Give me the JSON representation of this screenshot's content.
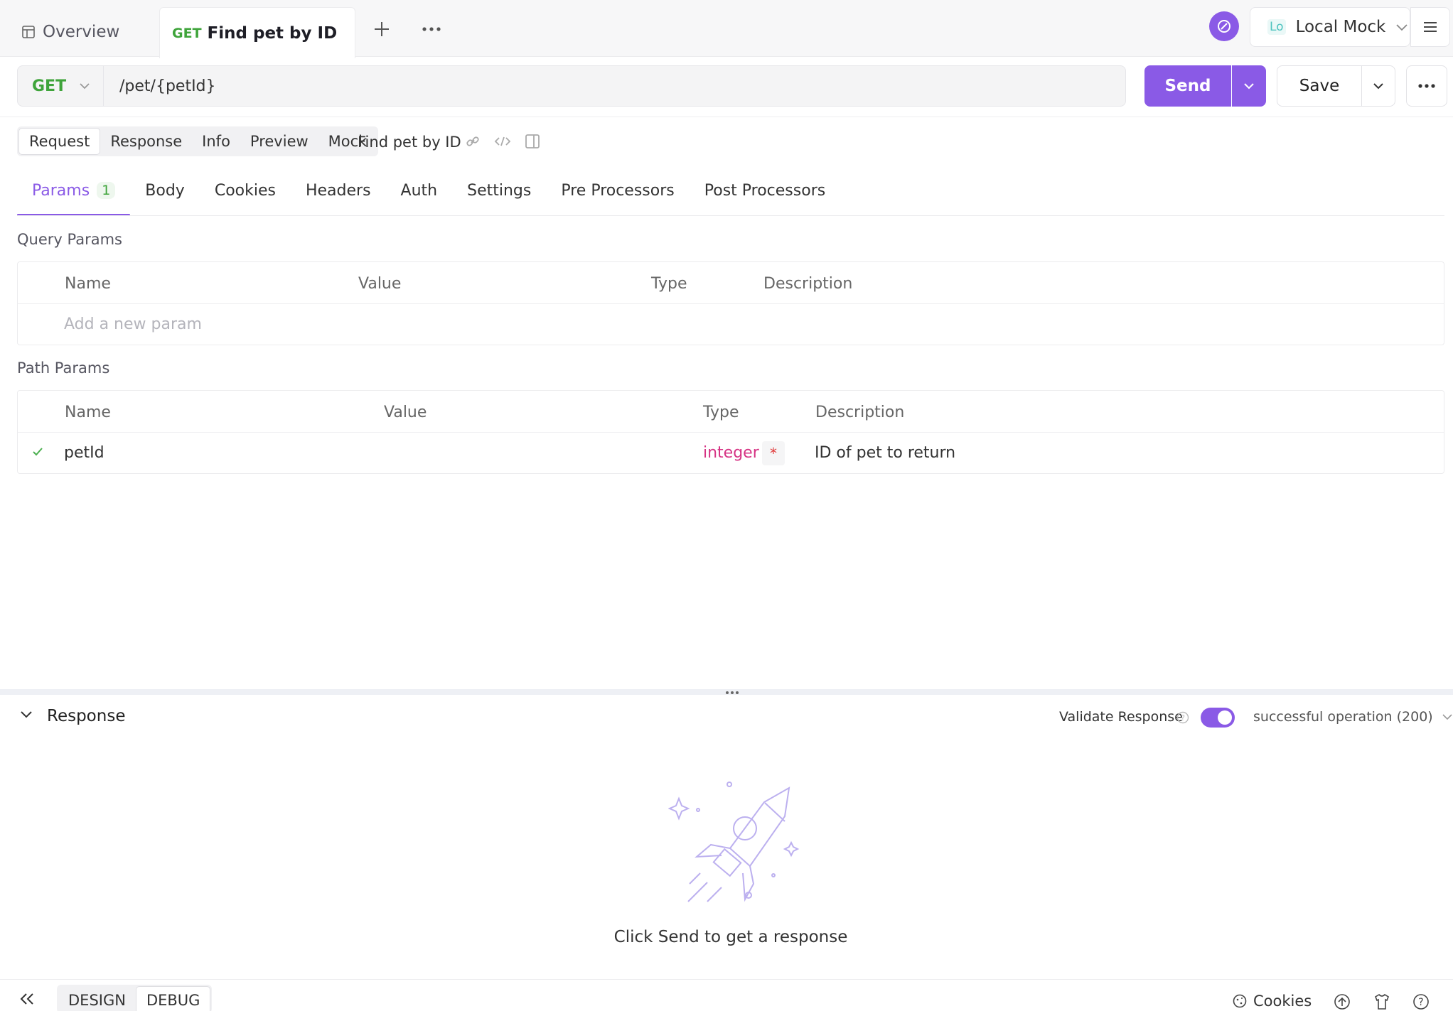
{
  "tabs": {
    "overview_label": "Overview",
    "active_method": "GET",
    "active_title": "Find pet by ID"
  },
  "environment": {
    "badge": "Lo",
    "name": "Local Mock"
  },
  "request": {
    "method": "GET",
    "url": "/pet/{petId}",
    "send_label": "Send",
    "save_label": "Save"
  },
  "views": {
    "items": [
      "Request",
      "Response",
      "Info",
      "Preview",
      "Mock"
    ],
    "active": "Request",
    "api_name": "Find pet by ID"
  },
  "param_tabs": {
    "items": [
      {
        "label": "Params",
        "count": "1"
      },
      {
        "label": "Body"
      },
      {
        "label": "Cookies"
      },
      {
        "label": "Headers"
      },
      {
        "label": "Auth"
      },
      {
        "label": "Settings"
      },
      {
        "label": "Pre Processors"
      },
      {
        "label": "Post Processors"
      }
    ]
  },
  "query_params": {
    "title": "Query Params",
    "columns": [
      "Name",
      "Value",
      "Type",
      "Description"
    ],
    "placeholder": "Add a new param"
  },
  "path_params": {
    "title": "Path Params",
    "columns": [
      "Name",
      "Value",
      "Type",
      "Description"
    ],
    "rows": [
      {
        "name": "petId",
        "value": "",
        "type": "integer",
        "required_mark": "*",
        "description": "ID of pet to return"
      }
    ]
  },
  "response": {
    "title": "Response",
    "validate_label": "Validate Response",
    "validate_on": true,
    "status_select": "successful operation (200)",
    "empty_message": "Click Send to get a response"
  },
  "bottom": {
    "modes": [
      "DESIGN",
      "DEBUG"
    ],
    "active_mode": "DEBUG",
    "cookies_label": "Cookies"
  },
  "colors": {
    "accent": "#8a5ae6",
    "get": "#3fa43b",
    "type": "#d63384"
  },
  "icons": [
    "overview-icon",
    "plus-icon",
    "more-dots-icon",
    "sync-icon",
    "chevron-down-icon",
    "hamburger-menu-icon",
    "link-icon",
    "code-icon",
    "panel-icon",
    "check-icon",
    "help-icon",
    "rocket-icon",
    "collapse-left-icon",
    "cookie-icon",
    "upload-icon",
    "shirt-icon",
    "question-icon"
  ]
}
